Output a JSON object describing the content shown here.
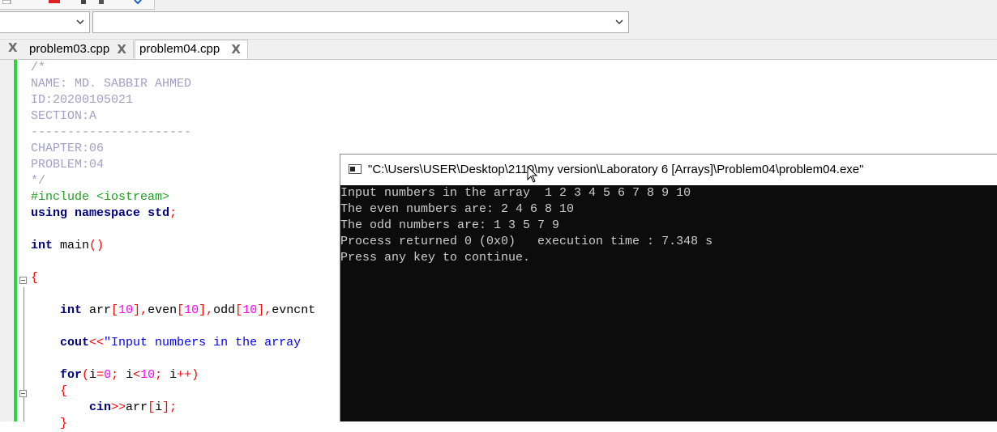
{
  "tabs": [
    {
      "label": "problem03.cpp",
      "active": false
    },
    {
      "label": "problem04.cpp",
      "active": true
    }
  ],
  "tab_close_glyph": "X",
  "code_lines": [
    [
      {
        "t": "/*",
        "c": "com"
      }
    ],
    [
      {
        "t": "NAME: MD. SABBIR AHMED",
        "c": "com"
      }
    ],
    [
      {
        "t": "ID:20200105021",
        "c": "com"
      }
    ],
    [
      {
        "t": "SECTION:A",
        "c": "com"
      }
    ],
    [
      {
        "t": "----------------------",
        "c": "com"
      }
    ],
    [
      {
        "t": "CHAPTER:06",
        "c": "com"
      }
    ],
    [
      {
        "t": "PROBLEM:04",
        "c": "com"
      }
    ],
    [
      {
        "t": "*/",
        "c": "com"
      }
    ],
    [
      {
        "t": "#include <iostream>",
        "c": "pre"
      }
    ],
    [
      {
        "t": "using",
        "c": "kw"
      },
      {
        "t": " ",
        "c": "id"
      },
      {
        "t": "namespace",
        "c": "kw"
      },
      {
        "t": " ",
        "c": "id"
      },
      {
        "t": "std",
        "c": "kw"
      },
      {
        "t": ";",
        "c": "op"
      }
    ],
    [],
    [
      {
        "t": "int",
        "c": "ty"
      },
      {
        "t": " main",
        "c": "id"
      },
      {
        "t": "()",
        "c": "op"
      }
    ],
    [],
    [
      {
        "t": "{",
        "c": "op"
      }
    ],
    [],
    [
      {
        "t": "    ",
        "c": "id"
      },
      {
        "t": "int",
        "c": "ty"
      },
      {
        "t": " arr",
        "c": "id"
      },
      {
        "t": "[",
        "c": "op"
      },
      {
        "t": "10",
        "c": "num"
      },
      {
        "t": "],",
        "c": "op"
      },
      {
        "t": "even",
        "c": "id"
      },
      {
        "t": "[",
        "c": "op"
      },
      {
        "t": "10",
        "c": "num"
      },
      {
        "t": "],",
        "c": "op"
      },
      {
        "t": "odd",
        "c": "id"
      },
      {
        "t": "[",
        "c": "op"
      },
      {
        "t": "10",
        "c": "num"
      },
      {
        "t": "],",
        "c": "op"
      },
      {
        "t": "evncnt",
        "c": "id"
      }
    ],
    [],
    [
      {
        "t": "    ",
        "c": "id"
      },
      {
        "t": "cout",
        "c": "kw"
      },
      {
        "t": "<<",
        "c": "op"
      },
      {
        "t": "\"Input numbers in the array",
        "c": "str"
      }
    ],
    [],
    [
      {
        "t": "    ",
        "c": "id"
      },
      {
        "t": "for",
        "c": "kw"
      },
      {
        "t": "(",
        "c": "op"
      },
      {
        "t": "i",
        "c": "id"
      },
      {
        "t": "=",
        "c": "op"
      },
      {
        "t": "0",
        "c": "num"
      },
      {
        "t": "; ",
        "c": "op"
      },
      {
        "t": "i",
        "c": "id"
      },
      {
        "t": "<",
        "c": "op"
      },
      {
        "t": "10",
        "c": "num"
      },
      {
        "t": "; ",
        "c": "op"
      },
      {
        "t": "i",
        "c": "id"
      },
      {
        "t": "++)",
        "c": "op"
      }
    ],
    [
      {
        "t": "    ",
        "c": "id"
      },
      {
        "t": "{",
        "c": "op"
      }
    ],
    [
      {
        "t": "        ",
        "c": "id"
      },
      {
        "t": "cin",
        "c": "kw"
      },
      {
        "t": ">>",
        "c": "op"
      },
      {
        "t": "arr",
        "c": "id"
      },
      {
        "t": "[",
        "c": "op"
      },
      {
        "t": "i",
        "c": "id"
      },
      {
        "t": "];",
        "c": "op"
      }
    ],
    [
      {
        "t": "    ",
        "c": "id"
      },
      {
        "t": "}",
        "c": "op"
      }
    ]
  ],
  "console": {
    "title": "\"C:\\Users\\USER\\Desktop\\2110\\my version\\Laboratory 6 [Arrays]\\Problem04\\problem04.exe\"",
    "lines": [
      "Input numbers in the array  1 2 3 4 5 6 7 8 9 10",
      "The even numbers are: 2 4 6 8 10",
      "The odd numbers are: 1 3 5 7 9",
      "Process returned 0 (0x0)   execution time : 7.348 s",
      "Press any key to continue."
    ]
  },
  "colors": {
    "change_bar": "#2ad43b",
    "comment": "#a0a0c8",
    "preprocessor": "#22a022",
    "keyword": "#000080",
    "string": "#0000ff",
    "number": "#ff00ff",
    "operator": "#ff0000",
    "console_bg": "#0c0c0c",
    "console_text": "#cccccc"
  }
}
